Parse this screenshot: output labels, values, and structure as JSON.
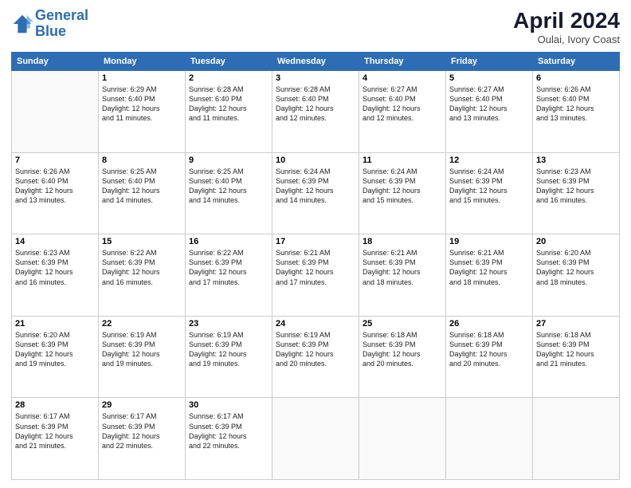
{
  "header": {
    "logo_line1": "General",
    "logo_line2": "Blue",
    "month": "April 2024",
    "location": "Oulai, Ivory Coast"
  },
  "weekdays": [
    "Sunday",
    "Monday",
    "Tuesday",
    "Wednesday",
    "Thursday",
    "Friday",
    "Saturday"
  ],
  "weeks": [
    [
      {
        "day": "",
        "info": ""
      },
      {
        "day": "1",
        "info": "Sunrise: 6:29 AM\nSunset: 6:40 PM\nDaylight: 12 hours\nand 11 minutes."
      },
      {
        "day": "2",
        "info": "Sunrise: 6:28 AM\nSunset: 6:40 PM\nDaylight: 12 hours\nand 11 minutes."
      },
      {
        "day": "3",
        "info": "Sunrise: 6:28 AM\nSunset: 6:40 PM\nDaylight: 12 hours\nand 12 minutes."
      },
      {
        "day": "4",
        "info": "Sunrise: 6:27 AM\nSunset: 6:40 PM\nDaylight: 12 hours\nand 12 minutes."
      },
      {
        "day": "5",
        "info": "Sunrise: 6:27 AM\nSunset: 6:40 PM\nDaylight: 12 hours\nand 13 minutes."
      },
      {
        "day": "6",
        "info": "Sunrise: 6:26 AM\nSunset: 6:40 PM\nDaylight: 12 hours\nand 13 minutes."
      }
    ],
    [
      {
        "day": "7",
        "info": "Sunrise: 6:26 AM\nSunset: 6:40 PM\nDaylight: 12 hours\nand 13 minutes."
      },
      {
        "day": "8",
        "info": "Sunrise: 6:25 AM\nSunset: 6:40 PM\nDaylight: 12 hours\nand 14 minutes."
      },
      {
        "day": "9",
        "info": "Sunrise: 6:25 AM\nSunset: 6:40 PM\nDaylight: 12 hours\nand 14 minutes."
      },
      {
        "day": "10",
        "info": "Sunrise: 6:24 AM\nSunset: 6:39 PM\nDaylight: 12 hours\nand 14 minutes."
      },
      {
        "day": "11",
        "info": "Sunrise: 6:24 AM\nSunset: 6:39 PM\nDaylight: 12 hours\nand 15 minutes."
      },
      {
        "day": "12",
        "info": "Sunrise: 6:24 AM\nSunset: 6:39 PM\nDaylight: 12 hours\nand 15 minutes."
      },
      {
        "day": "13",
        "info": "Sunrise: 6:23 AM\nSunset: 6:39 PM\nDaylight: 12 hours\nand 16 minutes."
      }
    ],
    [
      {
        "day": "14",
        "info": "Sunrise: 6:23 AM\nSunset: 6:39 PM\nDaylight: 12 hours\nand 16 minutes."
      },
      {
        "day": "15",
        "info": "Sunrise: 6:22 AM\nSunset: 6:39 PM\nDaylight: 12 hours\nand 16 minutes."
      },
      {
        "day": "16",
        "info": "Sunrise: 6:22 AM\nSunset: 6:39 PM\nDaylight: 12 hours\nand 17 minutes."
      },
      {
        "day": "17",
        "info": "Sunrise: 6:21 AM\nSunset: 6:39 PM\nDaylight: 12 hours\nand 17 minutes."
      },
      {
        "day": "18",
        "info": "Sunrise: 6:21 AM\nSunset: 6:39 PM\nDaylight: 12 hours\nand 18 minutes."
      },
      {
        "day": "19",
        "info": "Sunrise: 6:21 AM\nSunset: 6:39 PM\nDaylight: 12 hours\nand 18 minutes."
      },
      {
        "day": "20",
        "info": "Sunrise: 6:20 AM\nSunset: 6:39 PM\nDaylight: 12 hours\nand 18 minutes."
      }
    ],
    [
      {
        "day": "21",
        "info": "Sunrise: 6:20 AM\nSunset: 6:39 PM\nDaylight: 12 hours\nand 19 minutes."
      },
      {
        "day": "22",
        "info": "Sunrise: 6:19 AM\nSunset: 6:39 PM\nDaylight: 12 hours\nand 19 minutes."
      },
      {
        "day": "23",
        "info": "Sunrise: 6:19 AM\nSunset: 6:39 PM\nDaylight: 12 hours\nand 19 minutes."
      },
      {
        "day": "24",
        "info": "Sunrise: 6:19 AM\nSunset: 6:39 PM\nDaylight: 12 hours\nand 20 minutes."
      },
      {
        "day": "25",
        "info": "Sunrise: 6:18 AM\nSunset: 6:39 PM\nDaylight: 12 hours\nand 20 minutes."
      },
      {
        "day": "26",
        "info": "Sunrise: 6:18 AM\nSunset: 6:39 PM\nDaylight: 12 hours\nand 20 minutes."
      },
      {
        "day": "27",
        "info": "Sunrise: 6:18 AM\nSunset: 6:39 PM\nDaylight: 12 hours\nand 21 minutes."
      }
    ],
    [
      {
        "day": "28",
        "info": "Sunrise: 6:17 AM\nSunset: 6:39 PM\nDaylight: 12 hours\nand 21 minutes."
      },
      {
        "day": "29",
        "info": "Sunrise: 6:17 AM\nSunset: 6:39 PM\nDaylight: 12 hours\nand 22 minutes."
      },
      {
        "day": "30",
        "info": "Sunrise: 6:17 AM\nSunset: 6:39 PM\nDaylight: 12 hours\nand 22 minutes."
      },
      {
        "day": "",
        "info": ""
      },
      {
        "day": "",
        "info": ""
      },
      {
        "day": "",
        "info": ""
      },
      {
        "day": "",
        "info": ""
      }
    ]
  ]
}
